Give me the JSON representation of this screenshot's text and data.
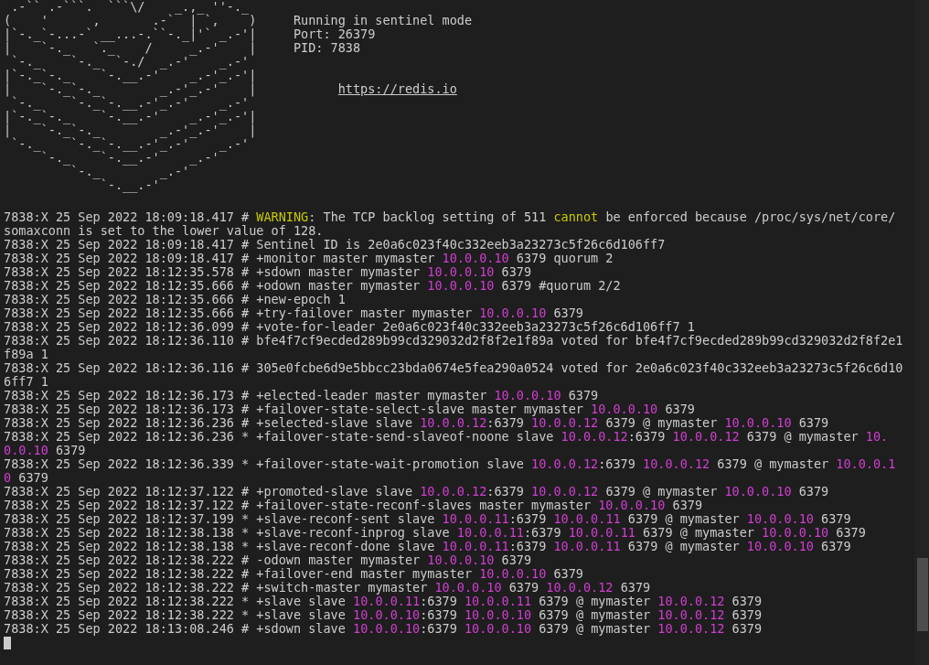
{
  "banner": {
    "art_lines": [
      " .-`` .-```.  ```\\/    _.,_ ''-._",
      "(    '      ,       .-`  | `,    )",
      "|`-._`-...-` __...-.``-._|'` _.-'|",
      "|    `-._   `._    /     _.-'    |",
      " `-._    `-._  `-./  _.-'    _.-'",
      "|`-._`-._    `-.__.-'    _.-'_.-'|",
      "|    `-._`-._        _.-'_.-'    |",
      " `-._    `-._`-.__.-'_.-'    _.-'",
      "|`-._`-._    `-.__.-'    _.-'_.-'|",
      "|    `-._`-._        _.-'_.-'    |",
      " `-._    `-._`-.__.-'_.-'    _.-'",
      "     `-._    `-.__.-'    _.-'",
      "         `-._        _.-'",
      "             `-.__.-'"
    ],
    "info": [
      "Running in sentinel mode",
      "Port: 26379",
      "PID: 7838"
    ],
    "link": "https://redis.io"
  },
  "log_lines": [
    {
      "segments": [
        {
          "kind": "text",
          "text": "7838:X 25 Sep 2022 18:09:18.417 # "
        },
        {
          "kind": "warn",
          "text": "WARNING"
        },
        {
          "kind": "text",
          "text": ": The TCP backlog setting of 511 "
        },
        {
          "kind": "warn",
          "text": "cannot"
        },
        {
          "kind": "text",
          "text": " be enforced because /proc/sys/net/core/somaxconn is set to the lower value of 128."
        }
      ]
    },
    {
      "segments": [
        {
          "kind": "text",
          "text": "7838:X 25 Sep 2022 18:09:18.417 # Sentinel ID is 2e0a6c023f40c332eeb3a23273c5f26c6d106ff7"
        }
      ]
    },
    {
      "segments": [
        {
          "kind": "text",
          "text": "7838:X 25 Sep 2022 18:09:18.417 # +monitor master mymaster "
        },
        {
          "kind": "ip",
          "text": "10.0.0.10"
        },
        {
          "kind": "text",
          "text": " 6379 quorum 2"
        }
      ]
    },
    {
      "segments": [
        {
          "kind": "text",
          "text": "7838:X 25 Sep 2022 18:12:35.578 # +sdown master mymaster "
        },
        {
          "kind": "ip",
          "text": "10.0.0.10"
        },
        {
          "kind": "text",
          "text": " 6379"
        }
      ]
    },
    {
      "segments": [
        {
          "kind": "text",
          "text": "7838:X 25 Sep 2022 18:12:35.666 # +odown master mymaster "
        },
        {
          "kind": "ip",
          "text": "10.0.0.10"
        },
        {
          "kind": "text",
          "text": " 6379 #quorum 2/2"
        }
      ]
    },
    {
      "segments": [
        {
          "kind": "text",
          "text": "7838:X 25 Sep 2022 18:12:35.666 # +new-epoch 1"
        }
      ]
    },
    {
      "segments": [
        {
          "kind": "text",
          "text": "7838:X 25 Sep 2022 18:12:35.666 # +try-failover master mymaster "
        },
        {
          "kind": "ip",
          "text": "10.0.0.10"
        },
        {
          "kind": "text",
          "text": " 6379"
        }
      ]
    },
    {
      "segments": [
        {
          "kind": "text",
          "text": "7838:X 25 Sep 2022 18:12:36.099 # +vote-for-leader 2e0a6c023f40c332eeb3a23273c5f26c6d106ff7 1"
        }
      ]
    },
    {
      "segments": [
        {
          "kind": "text",
          "text": "7838:X 25 Sep 2022 18:12:36.110 # bfe4f7cf9ecded289b99cd329032d2f8f2e1f89a voted for bfe4f7cf9ecded289b99cd329032d2f8f2e1f89a 1"
        }
      ]
    },
    {
      "segments": [
        {
          "kind": "text",
          "text": "7838:X 25 Sep 2022 18:12:36.116 # 305e0fcbe6d9e5bbcc23bda0674e5fea290a0524 voted for 2e0a6c023f40c332eeb3a23273c5f26c6d106ff7 1"
        }
      ]
    },
    {
      "segments": [
        {
          "kind": "text",
          "text": "7838:X 25 Sep 2022 18:12:36.173 # +elected-leader master mymaster "
        },
        {
          "kind": "ip",
          "text": "10.0.0.10"
        },
        {
          "kind": "text",
          "text": " 6379"
        }
      ]
    },
    {
      "segments": [
        {
          "kind": "text",
          "text": "7838:X 25 Sep 2022 18:12:36.173 # +failover-state-select-slave master mymaster "
        },
        {
          "kind": "ip",
          "text": "10.0.0.10"
        },
        {
          "kind": "text",
          "text": " 6379"
        }
      ]
    },
    {
      "segments": [
        {
          "kind": "text",
          "text": "7838:X 25 Sep 2022 18:12:36.236 # +selected-slave slave "
        },
        {
          "kind": "ip",
          "text": "10.0.0.12"
        },
        {
          "kind": "text",
          "text": ":6379 "
        },
        {
          "kind": "ip",
          "text": "10.0.0.12"
        },
        {
          "kind": "text",
          "text": " 6379 @ mymaster "
        },
        {
          "kind": "ip",
          "text": "10.0.0.10"
        },
        {
          "kind": "text",
          "text": " 6379"
        }
      ]
    },
    {
      "segments": [
        {
          "kind": "text",
          "text": "7838:X 25 Sep 2022 18:12:36.236 * +failover-state-send-slaveof-noone slave "
        },
        {
          "kind": "ip",
          "text": "10.0.0.12"
        },
        {
          "kind": "text",
          "text": ":6379 "
        },
        {
          "kind": "ip",
          "text": "10.0.0.12"
        },
        {
          "kind": "text",
          "text": " 6379 @ mymaster "
        },
        {
          "kind": "ip",
          "text": "10.0.0.10"
        },
        {
          "kind": "text",
          "text": " 6379"
        }
      ]
    },
    {
      "segments": [
        {
          "kind": "text",
          "text": "7838:X 25 Sep 2022 18:12:36.339 * +failover-state-wait-promotion slave "
        },
        {
          "kind": "ip",
          "text": "10.0.0.12"
        },
        {
          "kind": "text",
          "text": ":6379 "
        },
        {
          "kind": "ip",
          "text": "10.0.0.12"
        },
        {
          "kind": "text",
          "text": " 6379 @ mymaster "
        },
        {
          "kind": "ip",
          "text": "10.0.0.10"
        },
        {
          "kind": "text",
          "text": " 6379"
        }
      ]
    },
    {
      "segments": [
        {
          "kind": "text",
          "text": "7838:X 25 Sep 2022 18:12:37.122 # +promoted-slave slave "
        },
        {
          "kind": "ip",
          "text": "10.0.0.12"
        },
        {
          "kind": "text",
          "text": ":6379 "
        },
        {
          "kind": "ip",
          "text": "10.0.0.12"
        },
        {
          "kind": "text",
          "text": " 6379 @ mymaster "
        },
        {
          "kind": "ip",
          "text": "10.0.0.10"
        },
        {
          "kind": "text",
          "text": " 6379"
        }
      ]
    },
    {
      "segments": [
        {
          "kind": "text",
          "text": "7838:X 25 Sep 2022 18:12:37.122 # +failover-state-reconf-slaves master mymaster "
        },
        {
          "kind": "ip",
          "text": "10.0.0.10"
        },
        {
          "kind": "text",
          "text": " 6379"
        }
      ]
    },
    {
      "segments": [
        {
          "kind": "text",
          "text": "7838:X 25 Sep 2022 18:12:37.199 * +slave-reconf-sent slave "
        },
        {
          "kind": "ip",
          "text": "10.0.0.11"
        },
        {
          "kind": "text",
          "text": ":6379 "
        },
        {
          "kind": "ip",
          "text": "10.0.0.11"
        },
        {
          "kind": "text",
          "text": " 6379 @ mymaster "
        },
        {
          "kind": "ip",
          "text": "10.0.0.10"
        },
        {
          "kind": "text",
          "text": " 6379"
        }
      ]
    },
    {
      "segments": [
        {
          "kind": "text",
          "text": "7838:X 25 Sep 2022 18:12:38.138 * +slave-reconf-inprog slave "
        },
        {
          "kind": "ip",
          "text": "10.0.0.11"
        },
        {
          "kind": "text",
          "text": ":6379 "
        },
        {
          "kind": "ip",
          "text": "10.0.0.11"
        },
        {
          "kind": "text",
          "text": " 6379 @ mymaster "
        },
        {
          "kind": "ip",
          "text": "10.0.0.10"
        },
        {
          "kind": "text",
          "text": " 6379"
        }
      ]
    },
    {
      "segments": [
        {
          "kind": "text",
          "text": "7838:X 25 Sep 2022 18:12:38.138 * +slave-reconf-done slave "
        },
        {
          "kind": "ip",
          "text": "10.0.0.11"
        },
        {
          "kind": "text",
          "text": ":6379 "
        },
        {
          "kind": "ip",
          "text": "10.0.0.11"
        },
        {
          "kind": "text",
          "text": " 6379 @ mymaster "
        },
        {
          "kind": "ip",
          "text": "10.0.0.10"
        },
        {
          "kind": "text",
          "text": " 6379"
        }
      ]
    },
    {
      "segments": [
        {
          "kind": "text",
          "text": "7838:X 25 Sep 2022 18:12:38.222 # -odown master mymaster "
        },
        {
          "kind": "ip",
          "text": "10.0.0.10"
        },
        {
          "kind": "text",
          "text": " 6379"
        }
      ]
    },
    {
      "segments": [
        {
          "kind": "text",
          "text": "7838:X 25 Sep 2022 18:12:38.222 # +failover-end master mymaster "
        },
        {
          "kind": "ip",
          "text": "10.0.0.10"
        },
        {
          "kind": "text",
          "text": " 6379"
        }
      ]
    },
    {
      "segments": [
        {
          "kind": "text",
          "text": "7838:X 25 Sep 2022 18:12:38.222 # +switch-master mymaster "
        },
        {
          "kind": "ip",
          "text": "10.0.0.10"
        },
        {
          "kind": "text",
          "text": " 6379 "
        },
        {
          "kind": "ip",
          "text": "10.0.0.12"
        },
        {
          "kind": "text",
          "text": " 6379"
        }
      ]
    },
    {
      "segments": [
        {
          "kind": "text",
          "text": "7838:X 25 Sep 2022 18:12:38.222 * +slave slave "
        },
        {
          "kind": "ip",
          "text": "10.0.0.11"
        },
        {
          "kind": "text",
          "text": ":6379 "
        },
        {
          "kind": "ip",
          "text": "10.0.0.11"
        },
        {
          "kind": "text",
          "text": " 6379 @ mymaster "
        },
        {
          "kind": "ip",
          "text": "10.0.0.12"
        },
        {
          "kind": "text",
          "text": " 6379"
        }
      ]
    },
    {
      "segments": [
        {
          "kind": "text",
          "text": "7838:X 25 Sep 2022 18:12:38.222 * +slave slave "
        },
        {
          "kind": "ip",
          "text": "10.0.0.10"
        },
        {
          "kind": "text",
          "text": ":6379 "
        },
        {
          "kind": "ip",
          "text": "10.0.0.10"
        },
        {
          "kind": "text",
          "text": " 6379 @ mymaster "
        },
        {
          "kind": "ip",
          "text": "10.0.0.12"
        },
        {
          "kind": "text",
          "text": " 6379"
        }
      ]
    },
    {
      "segments": [
        {
          "kind": "text",
          "text": "7838:X 25 Sep 2022 18:13:08.246 # +sdown slave "
        },
        {
          "kind": "ip",
          "text": "10.0.0.10"
        },
        {
          "kind": "text",
          "text": ":6379 "
        },
        {
          "kind": "ip",
          "text": "10.0.0.10"
        },
        {
          "kind": "text",
          "text": " 6379 @ mymaster "
        },
        {
          "kind": "ip",
          "text": "10.0.0.12"
        },
        {
          "kind": "text",
          "text": " 6379"
        }
      ]
    }
  ]
}
